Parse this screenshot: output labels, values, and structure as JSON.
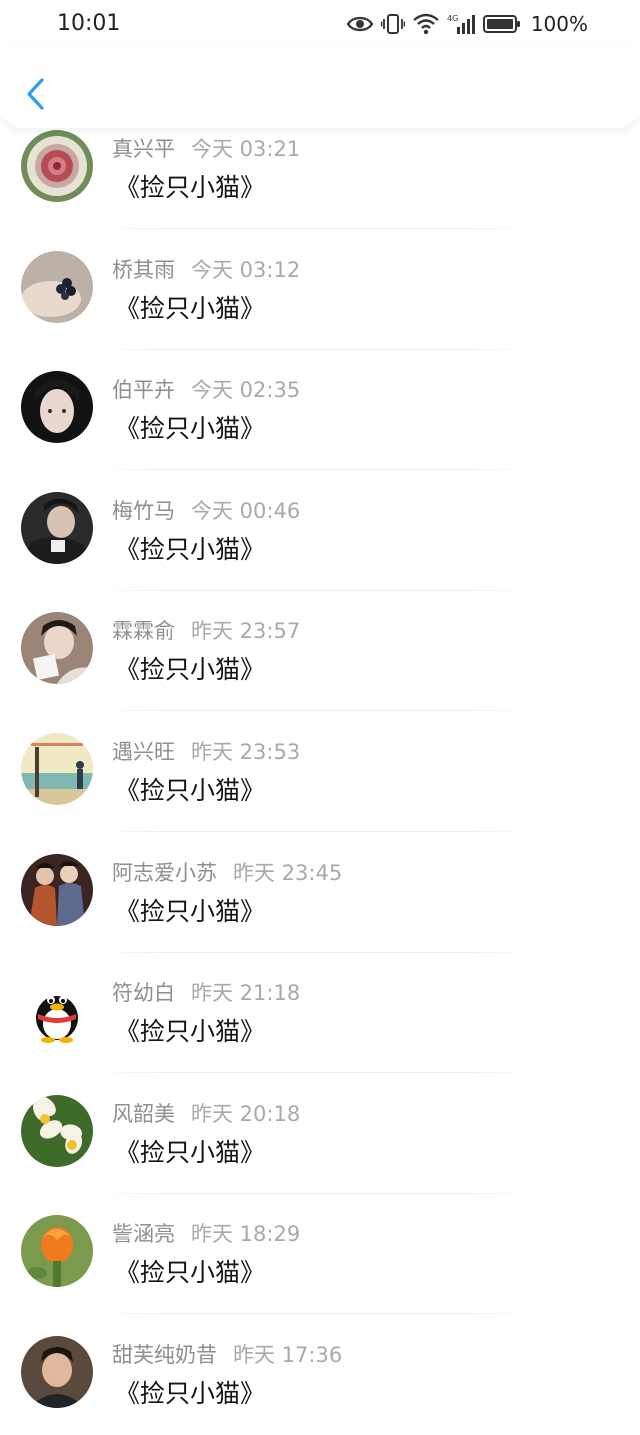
{
  "status_bar": {
    "time": "10:01",
    "battery": "100%",
    "icons": [
      "eye-icon",
      "vibrate-icon",
      "wifi-icon",
      "signal-4g-icon",
      "battery-icon"
    ]
  },
  "header": {
    "back_icon": "chevron-left-icon",
    "accent_color": "#2e9cf0"
  },
  "comments": [
    {
      "name": "真兴平",
      "time": "今天 03:21",
      "text": "《捡只小猫》",
      "avatar": "flower-carving"
    },
    {
      "name": "桥其雨",
      "time": "今天 03:12",
      "text": "《捡只小猫》",
      "avatar": "hand-berries"
    },
    {
      "name": "伯平卉",
      "time": "今天 02:35",
      "text": "《捡只小猫》",
      "avatar": "portrait-dark"
    },
    {
      "name": "梅竹马",
      "time": "今天 00:46",
      "text": "《捡只小猫》",
      "avatar": "portrait-suit"
    },
    {
      "name": "霖霖俞",
      "time": "昨天 23:57",
      "text": "《捡只小猫》",
      "avatar": "portrait-card"
    },
    {
      "name": "遇兴旺",
      "time": "昨天 23:53",
      "text": "《捡只小猫》",
      "avatar": "seaside"
    },
    {
      "name": "阿志爱小苏",
      "time": "昨天 23:45",
      "text": "《捡只小猫》",
      "avatar": "two-people"
    },
    {
      "name": "符幼白",
      "time": "昨天 21:18",
      "text": "《捡只小猫》",
      "avatar": "qq-penguin"
    },
    {
      "name": "风韶美",
      "time": "昨天 20:18",
      "text": "《捡只小猫》",
      "avatar": "white-flowers"
    },
    {
      "name": "訾涵亮",
      "time": "昨天 18:29",
      "text": "《捡只小猫》",
      "avatar": "orange-flower"
    },
    {
      "name": "甜芙纯奶昔",
      "time": "昨天 17:36",
      "text": "《捡只小猫》",
      "avatar": "child-portrait"
    }
  ]
}
